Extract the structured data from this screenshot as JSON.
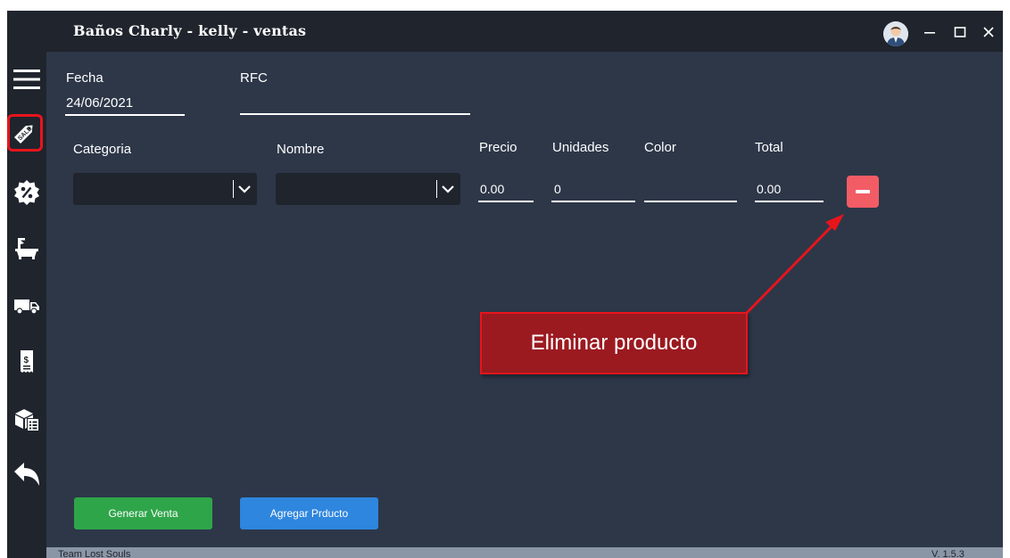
{
  "window": {
    "title": "Baños Charly - kelly - ventas",
    "controls": {
      "minimize": "—",
      "maximize": "☐",
      "close": "✕"
    }
  },
  "sidebar": {
    "items": [
      {
        "icon": "menu-icon"
      },
      {
        "icon": "sale-tag-icon",
        "active": true
      },
      {
        "icon": "discount-icon"
      },
      {
        "icon": "bathtub-icon"
      },
      {
        "icon": "truck-icon"
      },
      {
        "icon": "receipt-icon"
      },
      {
        "icon": "inventory-icon"
      },
      {
        "icon": "back-arrow-icon"
      }
    ]
  },
  "form": {
    "fecha_label": "Fecha",
    "fecha_value": "24/06/2021",
    "rfc_label": "RFC",
    "rfc_value": "",
    "categoria_label": "Categoria",
    "nombre_label": "Nombre",
    "precio_label": "Precio",
    "unidades_label": "Unidades",
    "color_label": "Color",
    "total_label": "Total",
    "precio_value": "0.00",
    "unidades_value": "0",
    "color_value": "",
    "total_value": "0.00"
  },
  "buttons": {
    "generar": "Generar Venta",
    "agregar": "Agregar Prducto"
  },
  "footer": {
    "left": "Team Lost Souls",
    "right": "V. 1.5.3"
  },
  "annotation": {
    "text": "Eliminar producto"
  },
  "colors": {
    "background": "#2d3748",
    "sidebar": "#1f242d",
    "remove": "#f25c65",
    "generar": "#2fa54a",
    "agregar": "#2e86de",
    "highlight": "#e8141c"
  }
}
